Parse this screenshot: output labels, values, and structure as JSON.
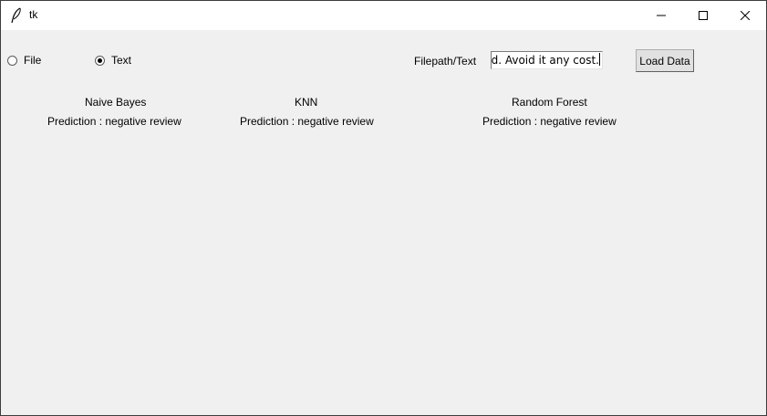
{
  "window": {
    "title": "tk",
    "app_icon": "tk-feather-icon",
    "controls": [
      "minimize-icon",
      "maximize-icon",
      "close-icon"
    ]
  },
  "input_mode": {
    "options": [
      {
        "label": "File",
        "selected": false
      },
      {
        "label": "Text",
        "selected": true
      }
    ]
  },
  "path_field": {
    "label": "Filepath/Text",
    "value": "ood. Avoid it any cost."
  },
  "load_button": {
    "label": "Load Data"
  },
  "models": [
    {
      "name": "Naive Bayes",
      "prediction": "Prediction : negative review"
    },
    {
      "name": "KNN",
      "prediction": "Prediction : negative review"
    },
    {
      "name": "Random Forest",
      "prediction": "Prediction : negative review"
    }
  ],
  "colors": {
    "background": "#f0f0f0",
    "titlebar": "#ffffff",
    "button_face": "#e1e1e1"
  }
}
